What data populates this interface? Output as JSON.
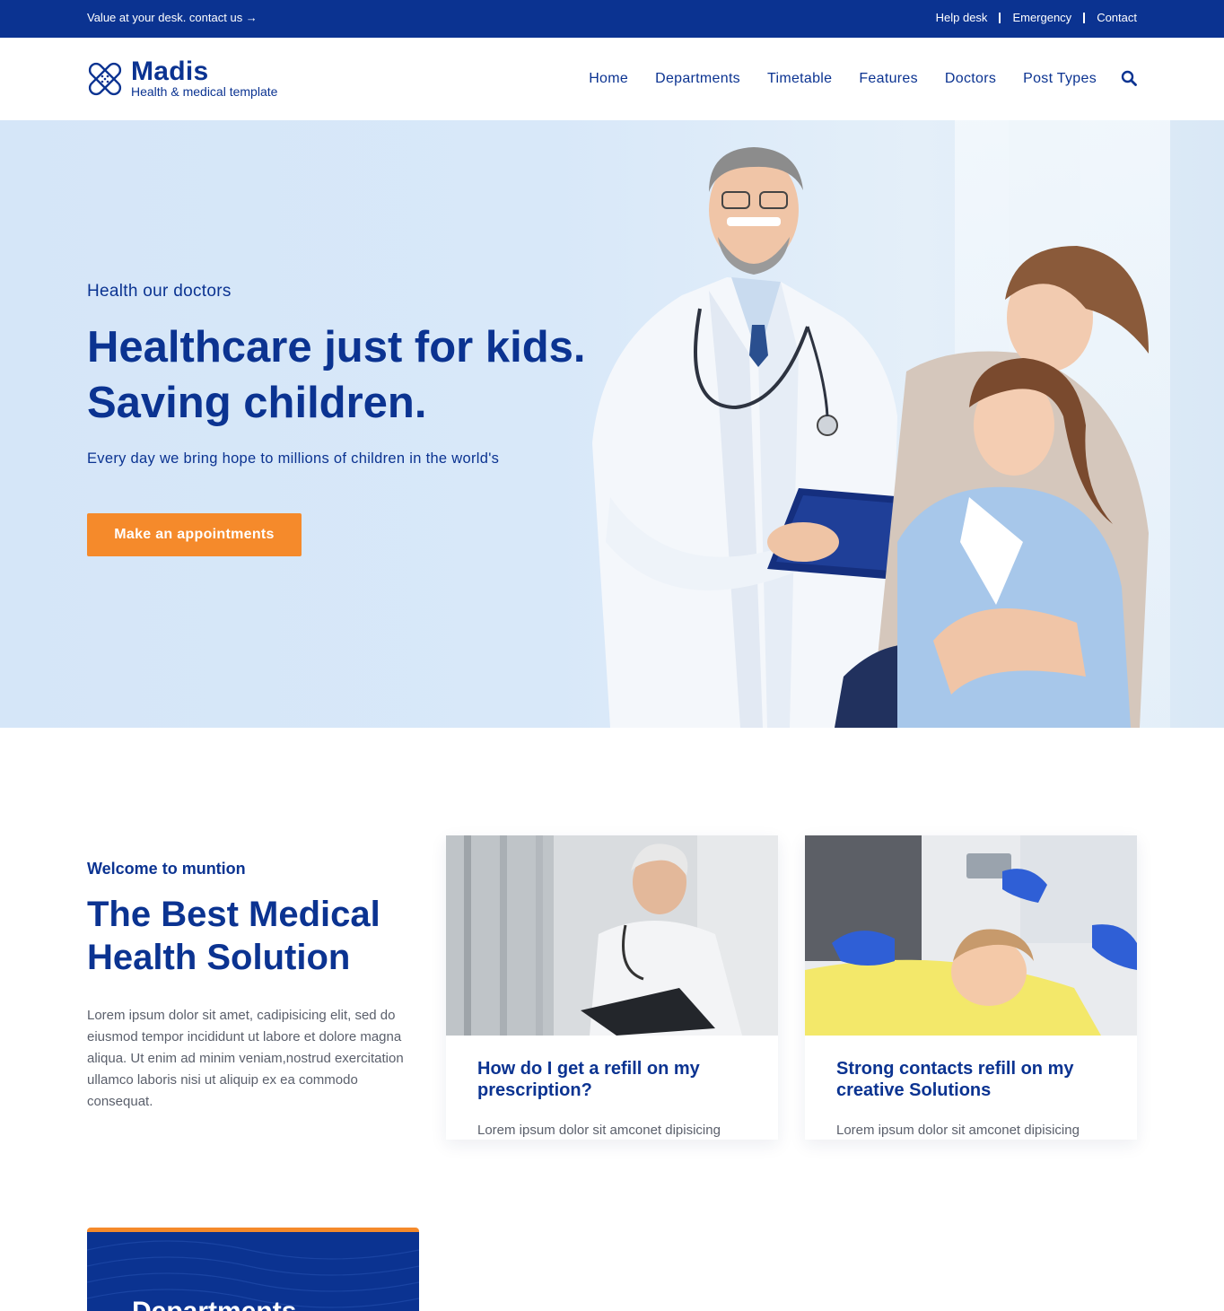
{
  "topbar": {
    "message": "Value at your desk. contact us →",
    "links": [
      "Help desk",
      "Emergency",
      "Contact"
    ]
  },
  "brand": {
    "name": "Madis",
    "tagline": "Health & medical template",
    "logo_icon": "bandage-icon"
  },
  "nav": {
    "items": [
      "Home",
      "Departments",
      "Timetable",
      "Features",
      "Doctors",
      "Post Types"
    ],
    "search_icon": "search-icon"
  },
  "hero": {
    "eyebrow": "Health our doctors",
    "title_line1": "Healthcare just for kids.",
    "title_line2": "Saving children.",
    "subtitle": "Every day we bring hope to millions of children in the world's",
    "cta": "Make an appointments"
  },
  "welcome": {
    "eyebrow": "Welcome to muntion",
    "title": "The Best Medical Health Solution",
    "body": "Lorem ipsum dolor sit amet, cadipisicing elit, sed do eiusmod tempor incididunt ut labore et dolore magna aliqua. Ut enim ad minim veniam,nostrud exercitation ullamco laboris nisi ut aliquip ex ea commodo consequat."
  },
  "cards": [
    {
      "title": "How do I get a refill on my prescription?",
      "excerpt": "Lorem ipsum dolor sit amconet dipisicing"
    },
    {
      "title": "Strong contacts refill on my creative Solutions",
      "excerpt": "Lorem ipsum dolor sit amconet dipisicing"
    }
  ],
  "departments": {
    "title": "Departments"
  },
  "colors": {
    "primary": "#0b3391",
    "accent": "#f58a2b",
    "hero_bg": "#d8e8f9",
    "body_text": "#5a5f6b"
  }
}
